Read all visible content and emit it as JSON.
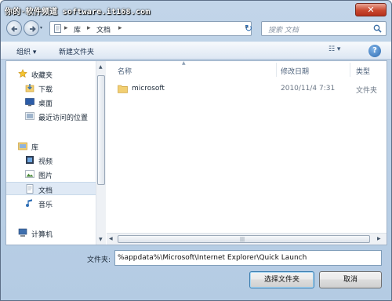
{
  "titlebar": {
    "watermark": "你的·软件频道 software.it168.com",
    "close_symbol": "✕"
  },
  "navbar": {
    "breadcrumb": [
      "库",
      "文档"
    ],
    "separator": "▸",
    "dropdown_symbol": "▾",
    "refresh_symbol": "↻",
    "search_placeholder": "搜索 文档"
  },
  "toolbar": {
    "organize_label": "组织 ▾",
    "new_folder_label": "新建文件夹",
    "view_symbol": "☷ ▾",
    "help_symbol": "?"
  },
  "sidebar": {
    "items": [
      {
        "label": "收藏夹",
        "icon": "star-icon"
      },
      {
        "label": "下载",
        "icon": "download-folder-icon"
      },
      {
        "label": "桌面",
        "icon": "desktop-icon"
      },
      {
        "label": "最近访问的位置",
        "icon": "recent-places-icon"
      },
      {
        "label": "库",
        "icon": "library-icon"
      },
      {
        "label": "视频",
        "icon": "video-icon"
      },
      {
        "label": "图片",
        "icon": "pictures-icon"
      },
      {
        "label": "文档",
        "icon": "documents-icon",
        "selected": true
      },
      {
        "label": "音乐",
        "icon": "music-icon"
      },
      {
        "label": "计算机",
        "icon": "computer-icon"
      }
    ]
  },
  "file_list": {
    "columns": {
      "name": "名称",
      "modified": "修改日期",
      "type": "类型"
    },
    "rows": [
      {
        "name": "microsoft",
        "modified": "2010/11/4 7:31",
        "type": "文件夹"
      }
    ]
  },
  "footer": {
    "folder_label": "文件夹:",
    "folder_value": "%appdata%\\Microsoft\\Internet Explorer\\Quick Launch",
    "select_button": "选择文件夹",
    "cancel_button": "取消"
  },
  "colors": {
    "accent": "#2e6bb0",
    "close": "#c9482f",
    "selection": "#dfe9f5"
  }
}
